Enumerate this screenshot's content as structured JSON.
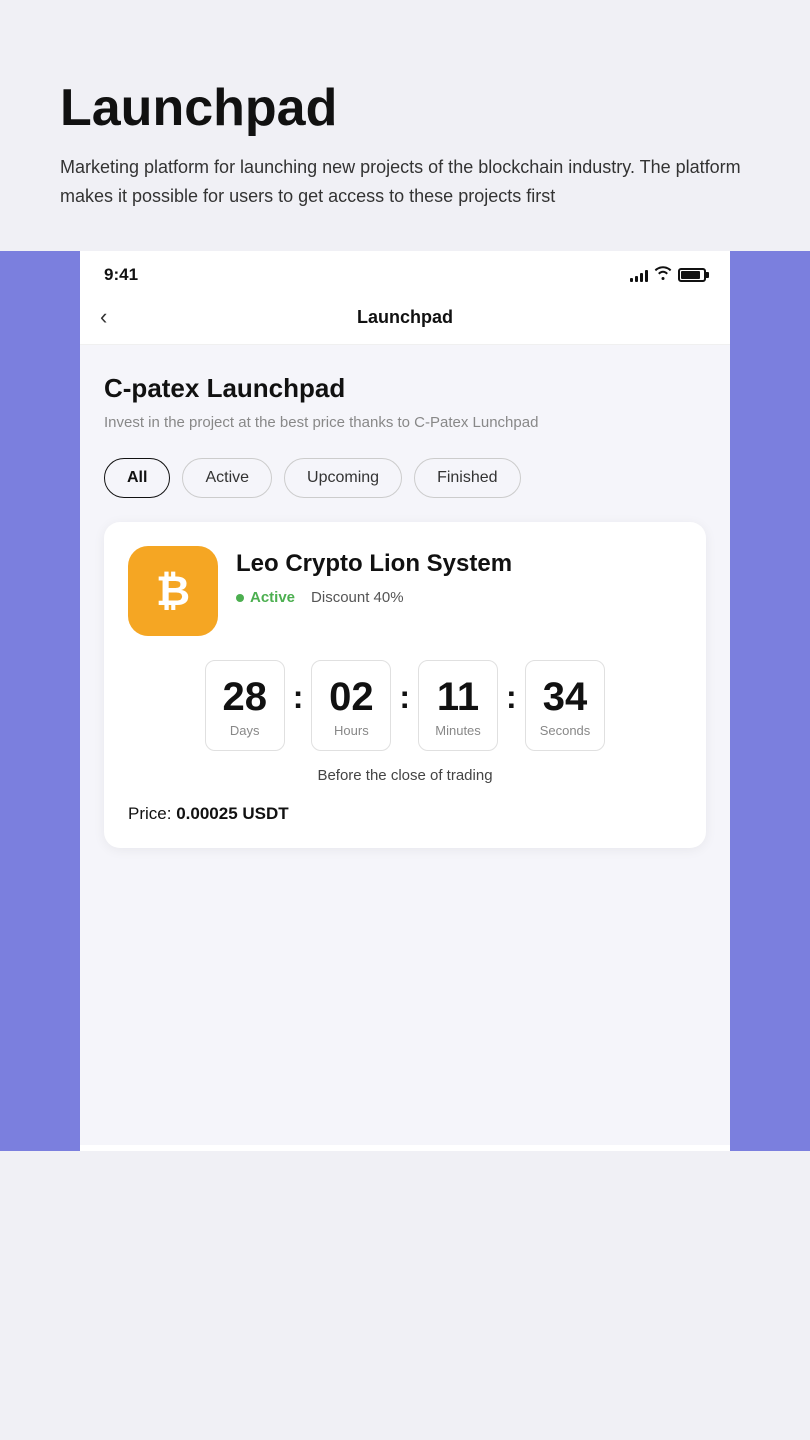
{
  "page": {
    "title": "Launchpad",
    "subtitle": "Marketing platform for launching new projects of the blockchain industry. The platform makes it possible for users to get access to these projects first"
  },
  "status_bar": {
    "time": "9:41",
    "signal_bars": [
      4,
      6,
      8,
      10,
      12
    ],
    "wifi": "WiFi",
    "battery": "Battery"
  },
  "nav": {
    "back_icon": "‹",
    "title": "Launchpad"
  },
  "content": {
    "section_title": "C-patex Launchpad",
    "section_desc": "Invest in the project at the best price thanks to C-Patex Lunchpad"
  },
  "filters": {
    "items": [
      {
        "label": "All",
        "active": true
      },
      {
        "label": "Active",
        "active": false
      },
      {
        "label": "Upcoming",
        "active": false
      },
      {
        "label": "Finished",
        "active": false
      }
    ]
  },
  "project": {
    "name": "Leo Crypto Lion System",
    "logo_symbol": "₿",
    "status": "Active",
    "discount": "Discount 40%",
    "countdown": {
      "days": {
        "value": "28",
        "label": "Days"
      },
      "hours": {
        "value": "02",
        "label": "Hours"
      },
      "minutes": {
        "value": "11",
        "label": "Minutes"
      },
      "seconds": {
        "value": "34",
        "label": "Seconds"
      }
    },
    "countdown_caption": "Before the close of trading",
    "price_label": "Price:",
    "price_value": "0.00025 USDT"
  }
}
